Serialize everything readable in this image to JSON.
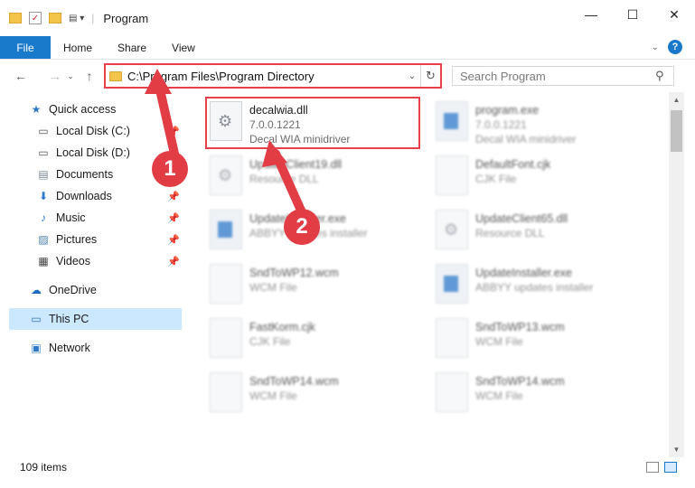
{
  "window": {
    "title": "Program",
    "minimize": "—",
    "maximize": "☐",
    "close": "✕"
  },
  "ribbon": {
    "file_tab": "File",
    "tabs": [
      "Home",
      "Share",
      "View"
    ],
    "help": "?"
  },
  "address": {
    "path": "C:\\Program Files\\Program Directory",
    "search_placeholder": "Search Program"
  },
  "sidebar": {
    "quick_access": "Quick access",
    "items": [
      {
        "label": "Local Disk (C:)",
        "icon": "drive-icon",
        "pinned": true
      },
      {
        "label": "Local Disk (D:)",
        "icon": "drive-icon",
        "pinned": false
      },
      {
        "label": "Documents",
        "icon": "documents-icon",
        "pinned": true
      },
      {
        "label": "Downloads",
        "icon": "downloads-icon",
        "pinned": true
      },
      {
        "label": "Music",
        "icon": "music-icon",
        "pinned": true
      },
      {
        "label": "Pictures",
        "icon": "pictures-icon",
        "pinned": true
      },
      {
        "label": "Videos",
        "icon": "videos-icon",
        "pinned": true
      }
    ],
    "onedrive": "OneDrive",
    "this_pc": "This PC",
    "network": "Network"
  },
  "files": [
    {
      "name": "decalwia.dll",
      "line2": "7.0.0.1221",
      "line3": "Decal WIA minidriver",
      "icon": "gear"
    },
    {
      "name": "program.exe",
      "line2": "7.0.0.1221",
      "line3": "Decal WIA minidriver",
      "icon": "exe"
    },
    {
      "name": "UpdateClient19.dll",
      "line2": "Resource DLL",
      "icon": "gear"
    },
    {
      "name": "DefaultFont.cjk",
      "line2": "CJK File",
      "icon": "doc"
    },
    {
      "name": "UpdateInstaller.exe",
      "line2": "ABBYY updates installer",
      "icon": "exe"
    },
    {
      "name": "UpdateClient65.dll",
      "line2": "Resource DLL",
      "icon": "gear"
    },
    {
      "name": "SndToWP12.wcm",
      "line2": "WCM File",
      "icon": "doc"
    },
    {
      "name": "UpdateInstaller.exe",
      "line2": "ABBYY updates installer",
      "icon": "exe"
    },
    {
      "name": "FastKorm.cjk",
      "line2": "CJK File",
      "icon": "doc"
    },
    {
      "name": "SndToWP13.wcm",
      "line2": "WCM File",
      "icon": "doc"
    },
    {
      "name": "SndToWP14.wcm",
      "line2": "WCM File",
      "icon": "doc"
    },
    {
      "name": "SndToWP14.wcm",
      "line2": "WCM File",
      "icon": "doc"
    }
  ],
  "status": {
    "count": "109 items"
  },
  "callouts": {
    "one": "1",
    "two": "2"
  },
  "colors": {
    "accent": "#1979ca",
    "highlight": "#e8414b",
    "selected": "#cce8ff"
  }
}
